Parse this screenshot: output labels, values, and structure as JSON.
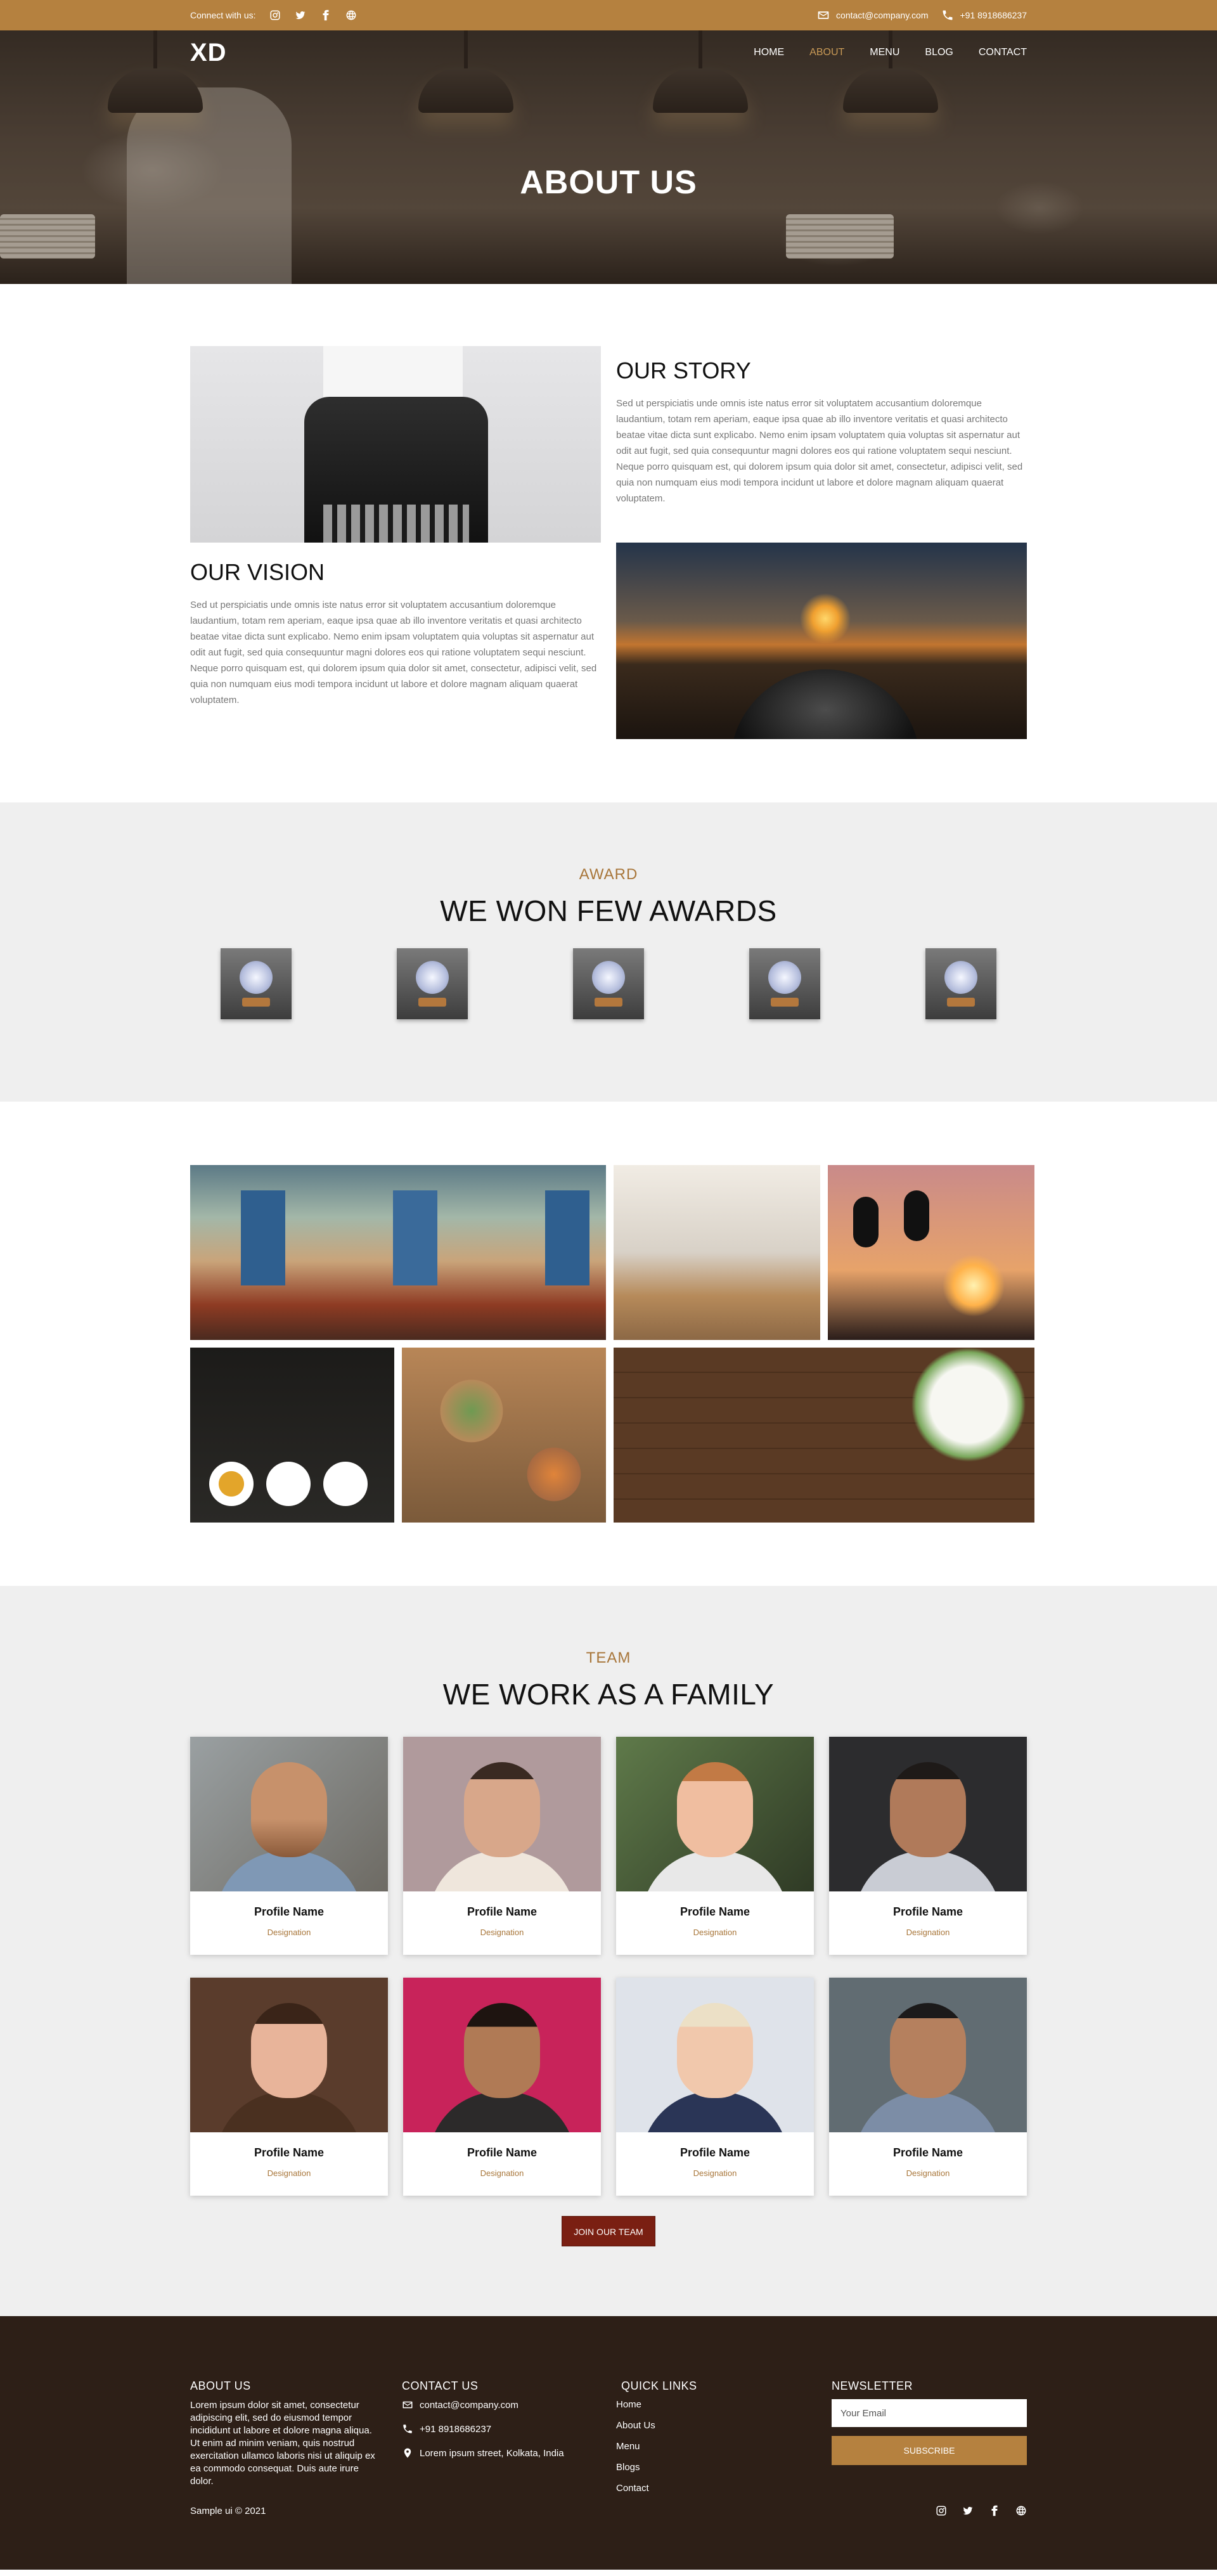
{
  "topbar": {
    "connect_label": "Connect with us:",
    "social_icons": [
      "instagram-icon",
      "twitter-icon",
      "facebook-icon",
      "globe-icon"
    ],
    "email": "contact@company.com",
    "phone": "+91 8918686237"
  },
  "nav": {
    "logo": "XD",
    "items": [
      {
        "label": "HOME",
        "active": false
      },
      {
        "label": "ABOUT",
        "active": true
      },
      {
        "label": "MENU",
        "active": false
      },
      {
        "label": "BLOG",
        "active": false
      },
      {
        "label": "CONTACT",
        "active": false
      }
    ]
  },
  "hero": {
    "title": "ABOUT US"
  },
  "story": {
    "title": "OUR STORY",
    "text": "Sed ut perspiciatis unde omnis iste natus error sit voluptatem accusantium doloremque laudantium, totam rem aperiam, eaque ipsa quae ab illo inventore veritatis et quasi architecto beatae vitae dicta sunt explicabo. Nemo enim ipsam voluptatem quia voluptas sit aspernatur aut odit aut fugit, sed quia consequuntur magni dolores eos qui ratione voluptatem sequi nesciunt. Neque porro quisquam est, qui dolorem ipsum quia dolor sit amet, consectetur, adipisci velit, sed quia non numquam eius modi tempora incidunt ut labore et dolore magnam aliquam quaerat voluptatem."
  },
  "vision": {
    "title": "OUR VISION",
    "text": "Sed ut perspiciatis unde omnis iste natus error sit voluptatem accusantium doloremque laudantium, totam rem aperiam, eaque ipsa quae ab illo inventore veritatis et quasi architecto beatae vitae dicta sunt explicabo. Nemo enim ipsam voluptatem quia voluptas sit aspernatur aut odit aut fugit, sed quia consequuntur magni dolores eos qui ratione voluptatem sequi nesciunt. Neque porro quisquam est, qui dolorem ipsum quia dolor sit amet, consectetur, adipisci velit, sed quia non numquam eius modi tempora incidunt ut labore et dolore magnam aliquam quaerat voluptatem."
  },
  "awards": {
    "kicker": "AWARD",
    "title": "WE WON FEW AWARDS",
    "count": 5
  },
  "team": {
    "kicker": "TEAM",
    "title": "WE WORK AS A FAMILY",
    "members": [
      {
        "name": "Profile Name",
        "designation": "Designation"
      },
      {
        "name": "Profile Name",
        "designation": "Designation"
      },
      {
        "name": "Profile Name",
        "designation": "Designation"
      },
      {
        "name": "Profile Name",
        "designation": "Designation"
      },
      {
        "name": "Profile Name",
        "designation": "Designation"
      },
      {
        "name": "Profile Name",
        "designation": "Designation"
      },
      {
        "name": "Profile Name",
        "designation": "Designation"
      },
      {
        "name": "Profile Name",
        "designation": "Designation"
      }
    ],
    "join_label": "JOIN OUR TEAM"
  },
  "footer": {
    "about_title": "ABOUT US",
    "about_text": "Lorem ipsum dolor sit amet, consectetur adipiscing elit, sed do eiusmod tempor incididunt ut labore et dolore magna aliqua. Ut enim ad minim veniam, quis nostrud exercitation ullamco laboris nisi ut aliquip ex ea commodo consequat. Duis aute irure dolor.",
    "contact_title": "CONTACT US",
    "email": "contact@company.com",
    "phone": "+91 8918686237",
    "address": "Lorem ipsum street, Kolkata, India",
    "quick_title": "QUICK LINKS",
    "quick_links": [
      "Home",
      "About Us",
      "Menu",
      "Blogs",
      "Contact"
    ],
    "newsletter_title": "NEWSLETTER",
    "newsletter_placeholder": "Your Email",
    "subscribe_label": "SUBSCRIBE",
    "copyright": "Sample ui © 2021"
  },
  "colors": {
    "accent": "#b5813f",
    "kicker": "#a8763a",
    "join_button": "#7a1f12",
    "footer_bg": "#2d1f17",
    "section_gray": "#efefef"
  }
}
